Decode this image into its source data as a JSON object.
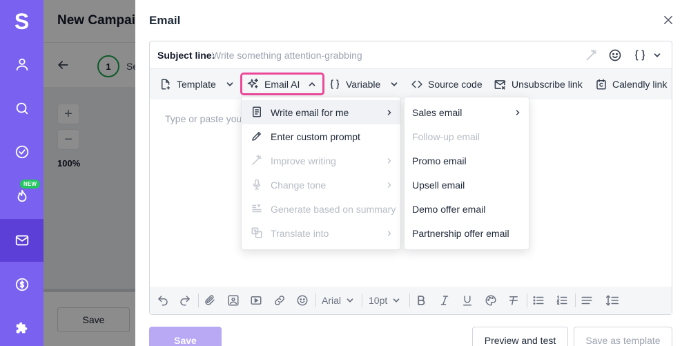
{
  "app": {
    "logo_letter": "S",
    "nav": [
      {
        "name": "contacts",
        "icon": "person-icon"
      },
      {
        "name": "search",
        "icon": "search-icon"
      },
      {
        "name": "tasks",
        "icon": "check-circle-icon"
      },
      {
        "name": "hot-leads",
        "icon": "flame-icon",
        "badge": "NEW"
      },
      {
        "name": "email",
        "icon": "mail-icon",
        "active": true
      },
      {
        "name": "billing",
        "icon": "dollar-icon"
      },
      {
        "name": "integrations",
        "icon": "puzzle-icon"
      }
    ]
  },
  "background": {
    "title": "New Campaign",
    "step_number": "1",
    "step_label": "Se",
    "zoom_in": "+",
    "zoom_out": "−",
    "zoom_level": "100%",
    "save_label": "Save"
  },
  "modal": {
    "title": "Email",
    "subject": {
      "label": "Subject line:",
      "placeholder": "Write something attention-grabbing"
    },
    "toolbar": {
      "template": "Template",
      "email_ai": "Email AI",
      "variable": "Variable",
      "source_code": "Source code",
      "unsubscribe": "Unsubscribe link",
      "calendly": "Calendly link"
    },
    "body_placeholder": "Type or paste your",
    "format": {
      "font": "Arial",
      "size": "10pt"
    },
    "footer": {
      "save": "Save",
      "preview": "Preview and test",
      "save_template": "Save as template"
    }
  },
  "ai_menu": {
    "items": [
      {
        "label": "Write email for me",
        "icon": "document-icon",
        "submenu": true,
        "disabled": false,
        "active": true
      },
      {
        "label": "Enter custom prompt",
        "icon": "pencil-icon",
        "submenu": false,
        "disabled": false
      },
      {
        "label": "Improve writing",
        "icon": "magic-wand-icon",
        "submenu": true,
        "disabled": true
      },
      {
        "label": "Change tone",
        "icon": "microphone-icon",
        "submenu": true,
        "disabled": true
      },
      {
        "label": "Generate based on summary",
        "icon": "summary-icon",
        "submenu": false,
        "disabled": true
      },
      {
        "label": "Translate into",
        "icon": "translate-icon",
        "submenu": true,
        "disabled": true
      }
    ]
  },
  "write_submenu": {
    "items": [
      {
        "label": "Sales email",
        "submenu": true,
        "disabled": false
      },
      {
        "label": "Follow-up email",
        "submenu": false,
        "disabled": true
      },
      {
        "label": "Promo email",
        "submenu": false,
        "disabled": false
      },
      {
        "label": "Upsell email",
        "submenu": false,
        "disabled": false
      },
      {
        "label": "Demo offer email",
        "submenu": false,
        "disabled": false
      },
      {
        "label": "Partnership offer email",
        "submenu": false,
        "disabled": false
      }
    ]
  },
  "colors": {
    "sidebar": "#7b61f0",
    "sidebar_active": "#5b3fd6",
    "accent_pink": "#ec4899",
    "primary_disabled": "#b9a9f5",
    "step_green": "#16a34a",
    "badge_green": "#22c55e"
  }
}
